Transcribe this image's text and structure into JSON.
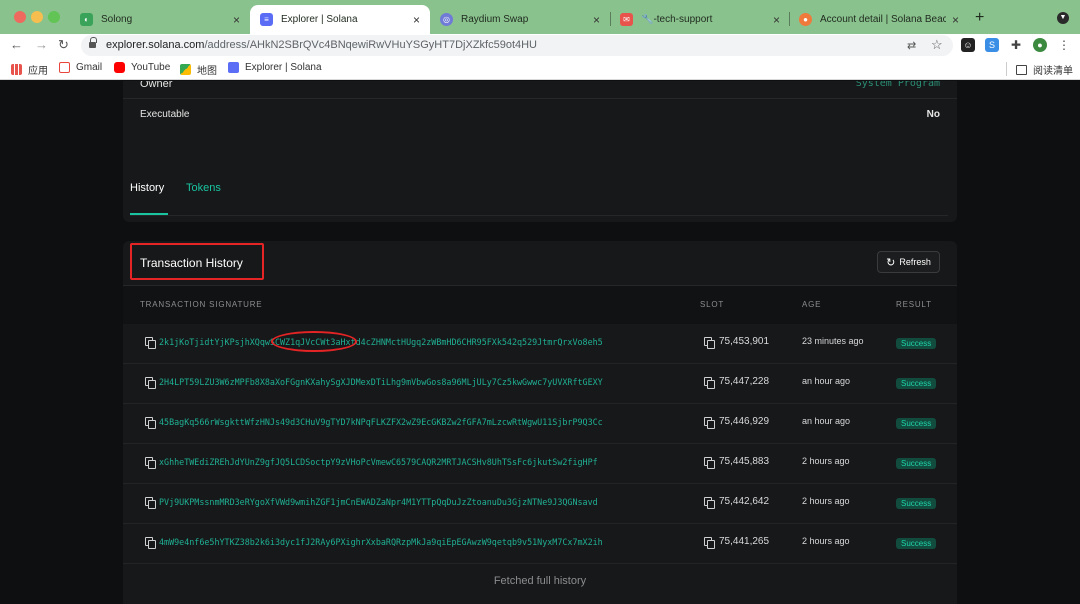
{
  "browser": {
    "tabs": [
      {
        "title": "Solong",
        "favicon_color": "#3aa35a"
      },
      {
        "title": "Explorer | Solana",
        "favicon_color": "#5b6cf5",
        "active": true
      },
      {
        "title": "Raydium Swap",
        "favicon_color": "#6f7bd6"
      },
      {
        "title": "🔧-tech-support",
        "favicon_color": "#e8534b"
      },
      {
        "title": "Account detail | Solana Beach",
        "favicon_color": "#ef7a3b"
      }
    ],
    "url_host": "explorer.solana.com",
    "url_path": "/address/AHkN2SBrQVc4BNqewiRwVHuYSGyHT7DjXZkfc59ot4HU",
    "bookmarks": [
      {
        "label": "应用",
        "color": "#e8534b"
      },
      {
        "label": "Gmail",
        "color": "#e8453c"
      },
      {
        "label": "YouTube",
        "color": "#ff0000"
      },
      {
        "label": "地图",
        "color": "#34a853"
      },
      {
        "label": "Explorer | Solana",
        "color": "#5b6cf5"
      }
    ],
    "reading_list": "阅读清单"
  },
  "account": {
    "owner_label": "Owner",
    "owner_value": "System Program",
    "executable_label": "Executable",
    "executable_value": "No"
  },
  "subtabs": {
    "history": "History",
    "tokens": "Tokens"
  },
  "history": {
    "title": "Transaction History",
    "refresh_label": "Refresh",
    "columns": {
      "signature": "TRANSACTION SIGNATURE",
      "slot": "SLOT",
      "age": "AGE",
      "result": "RESULT"
    },
    "rows": [
      {
        "signature": "2k1jKoTjidtYjKPsjhXQqwSCWZ1qJVcCWt3aHxtd4cZHNMctHUgq2zWBmHD6CHR95FXk542q529JtmrQrxVo8eh5",
        "slot": "75,453,901",
        "age": "23 minutes ago",
        "result": "Success"
      },
      {
        "signature": "2H4LPT59LZU3W6zMPFb8X8aXoFGgnKXahySgXJDMexDTiLhg9mVbwGos8a96MLjULy7Cz5kwGwwc7yUVXRftGEXY",
        "slot": "75,447,228",
        "age": "an hour ago",
        "result": "Success"
      },
      {
        "signature": "45BagKq566rWsgkttWfzHNJs49d3CHuV9gTYD7kNPqFLKZFX2wZ9EcGKBZw2fGFA7mLzcwRtWgwU11SjbrP9Q3Cc",
        "slot": "75,446,929",
        "age": "an hour ago",
        "result": "Success"
      },
      {
        "signature": "xGhheTWEdiZREhJdYUnZ9gfJQ5LCDSoctpY9zVHoPcVmewC6579CAQR2MRTJACSHv8UhTSsFc6jkutSw2figHPf",
        "slot": "75,445,883",
        "age": "2 hours ago",
        "result": "Success"
      },
      {
        "signature": "PVj9UKPMssnmMRD3eRYgoXfVWd9wmihZGF1jmCnEWADZaNpr4M1YTTpQqDuJzZtoanuDu3GjzNTNe9J3QGNsavd",
        "slot": "75,442,642",
        "age": "2 hours ago",
        "result": "Success"
      },
      {
        "signature": "4mW9e4nf6e5hYTKZ38b2k6i3dyc1fJ2RAy6PXighrXxbaRQRzpMkJa9qiEpEGAwzW9qetqb9v51NyxM7Cx7mX2ih",
        "slot": "75,441,265",
        "age": "2 hours ago",
        "result": "Success"
      }
    ],
    "footer": "Fetched full history"
  },
  "icons": {
    "refresh": "↻",
    "back": "←",
    "forward": "→",
    "reload": "↻",
    "star": "☆",
    "translate": "⇄",
    "new_tab": "+",
    "tab_close": "×"
  },
  "colors": {
    "accent": "#19c4a0",
    "annotation_red": "#e52425",
    "success_bg": "#114c3f"
  }
}
